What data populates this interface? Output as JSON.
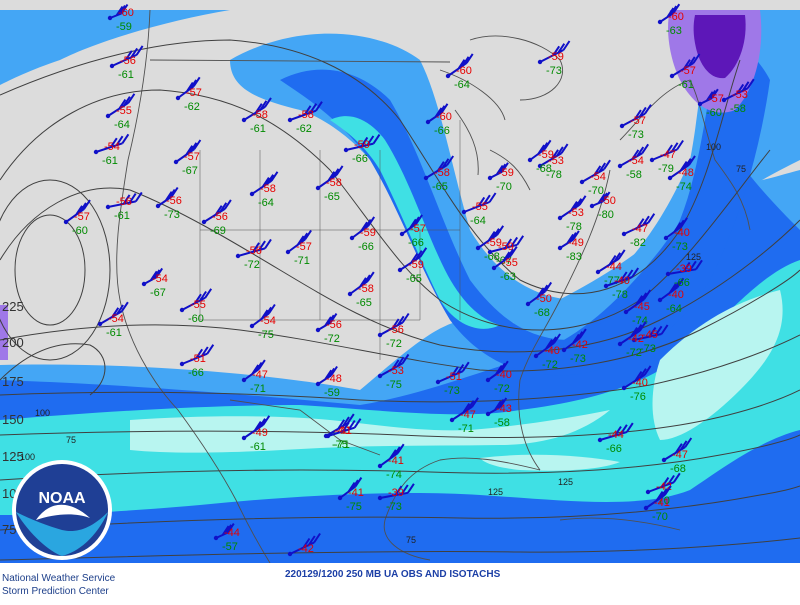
{
  "caption": "220129/1200 250 MB UA OBS AND ISOTACHS",
  "credit": {
    "line1": "National Weather Service",
    "line2": "Storm Prediction Center"
  },
  "logo": {
    "text": "NOAA"
  },
  "colors": {
    "background": "#dcdcdc",
    "isotach_75": "#44a6f5",
    "isotach_100": "#1f6cf0",
    "isotach_125": "#3fe0e4",
    "isotach_150": "#b8f5f0",
    "isotach_175": "#9f78e8",
    "isotach_200": "#5d17b8",
    "temperature": "#e60000",
    "dewpoint": "#008a00",
    "wind_barb": "#1010c8",
    "contour": "#404040"
  },
  "isotach_labels": [
    "225",
    "200",
    "175",
    "150",
    "125",
    "100",
    "75"
  ],
  "isotach_inline_labels": [
    "100",
    "75",
    "100",
    "125",
    "125",
    "75",
    "125",
    "100",
    "75"
  ],
  "stations": [
    {
      "t": "-60",
      "d": "-59"
    },
    {
      "t": "-56",
      "d": "-61"
    },
    {
      "t": "-55",
      "d": "-64"
    },
    {
      "t": "-54",
      "d": "-61"
    },
    {
      "t": "-57",
      "d": "-60"
    },
    {
      "t": "-56",
      "d": "-61"
    },
    {
      "t": "-57",
      "d": "-62"
    },
    {
      "t": "-57",
      "d": "-67"
    },
    {
      "t": "-56",
      "d": "-73"
    },
    {
      "t": "-56",
      "d": "-69"
    },
    {
      "t": "-54",
      "d": "-67"
    },
    {
      "t": "-55",
      "d": "-60"
    },
    {
      "t": "-54",
      "d": "-61"
    },
    {
      "t": "-51",
      "d": "-66"
    },
    {
      "t": "-58",
      "d": "-64"
    },
    {
      "t": "-56",
      "d": "-72"
    },
    {
      "t": "-57",
      "d": "-71"
    },
    {
      "t": "-54",
      "d": "-75"
    },
    {
      "t": "-47",
      "d": "-71"
    },
    {
      "t": "-49",
      "d": "-61"
    },
    {
      "t": "-48",
      "d": "-59"
    },
    {
      "t": "-48",
      "d": "-75"
    },
    {
      "t": "-44",
      "d": "-57"
    },
    {
      "t": "-42",
      "d": ""
    },
    {
      "t": "-58",
      "d": "-61"
    },
    {
      "t": "-58",
      "d": "-62"
    },
    {
      "t": "-58",
      "d": "-65"
    },
    {
      "t": "-59",
      "d": "-66"
    },
    {
      "t": "-59",
      "d": "-66"
    },
    {
      "t": "-58",
      "d": "-65"
    },
    {
      "t": "-57",
      "d": "-66"
    },
    {
      "t": "-59",
      "d": "-65"
    },
    {
      "t": "-56",
      "d": "-72"
    },
    {
      "t": "-56",
      "d": "-72"
    },
    {
      "t": "-53",
      "d": "-75"
    },
    {
      "t": "-51",
      "d": "-73"
    },
    {
      "t": "-47",
      "d": "-71"
    },
    {
      "t": "-41",
      "d": "-71"
    },
    {
      "t": "-41",
      "d": "-74"
    },
    {
      "t": "-39",
      "d": "-73"
    },
    {
      "t": "-41",
      "d": "-75"
    },
    {
      "t": "-60",
      "d": "-64"
    },
    {
      "t": "-60",
      "d": "-66"
    },
    {
      "t": "-58",
      "d": "-65"
    },
    {
      "t": "-59",
      "d": "-70"
    },
    {
      "t": "-59",
      "d": "-73"
    },
    {
      "t": "-53",
      "d": "-78"
    },
    {
      "t": "-55",
      "d": "-64"
    },
    {
      "t": "-59",
      "d": "-68"
    },
    {
      "t": "-59",
      "d": "-67"
    },
    {
      "t": "-55",
      "d": "-63"
    },
    {
      "t": "-50",
      "d": "-68"
    },
    {
      "t": "-59",
      "d": "-68"
    },
    {
      "t": "-53",
      "d": "-78"
    },
    {
      "t": "-49",
      "d": "-83"
    },
    {
      "t": "-54",
      "d": "-70"
    },
    {
      "t": "-50",
      "d": "-80"
    },
    {
      "t": "-47",
      "d": "-82"
    },
    {
      "t": "-44",
      "d": "-77"
    },
    {
      "t": "-40",
      "d": "-78"
    },
    {
      "t": "-45",
      "d": "-74"
    },
    {
      "t": "-45",
      "d": "-73"
    },
    {
      "t": "-42",
      "d": "-73"
    },
    {
      "t": "-40",
      "d": "-72"
    },
    {
      "t": "-40",
      "d": "-72"
    },
    {
      "t": "-40",
      "d": "-76"
    },
    {
      "t": "-43",
      "d": "-58"
    },
    {
      "t": "-57",
      "d": "-73"
    },
    {
      "t": "-54",
      "d": "-58"
    },
    {
      "t": "-47",
      "d": "-79"
    },
    {
      "t": "-42",
      "d": "-72"
    },
    {
      "t": "-44",
      "d": "-66"
    },
    {
      "t": "-40",
      "d": "-64"
    },
    {
      "t": "-39",
      "d": "-66"
    },
    {
      "t": "-40",
      "d": "-73"
    },
    {
      "t": "-48",
      "d": "-74"
    },
    {
      "t": "-60",
      "d": "-63"
    },
    {
      "t": "-57",
      "d": "-61"
    },
    {
      "t": "-57",
      "d": "-60"
    },
    {
      "t": "-53",
      "d": "-58"
    },
    {
      "t": "-47",
      "d": "-68"
    },
    {
      "t": "-42",
      "d": "-70"
    },
    {
      "t": "-41",
      "d": "-70"
    }
  ]
}
